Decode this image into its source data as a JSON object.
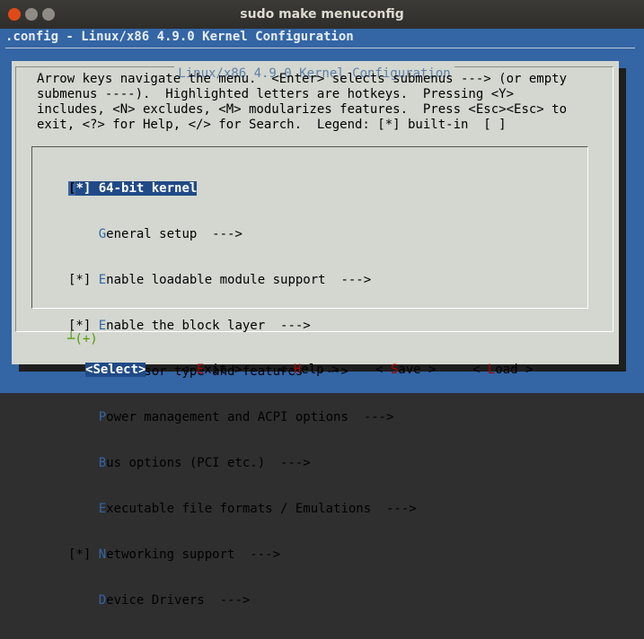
{
  "window": {
    "title": "sudo make menuconfig"
  },
  "terminal": {
    "config_title": ".config - Linux/x86 4.9.0 Kernel Configuration"
  },
  "dialog": {
    "title": "Linux/x86 4.9.0 Kernel Configuration",
    "help_lines": [
      "Arrow keys navigate the menu.  <Enter> selects submenus ---> (or empty",
      "submenus ----).  Highlighted letters are hotkeys.  Pressing <Y>",
      "includes, <N> excludes, <M> modularizes features.  Press <Esc><Esc> to",
      "exit, <?> for Help, </> for Search.  Legend: [*] built-in  [ ]"
    ]
  },
  "menu": {
    "items": [
      {
        "prefix": "[*] ",
        "hot": "6",
        "rest": "4-bit kernel",
        "selected": true
      },
      {
        "prefix": "    ",
        "hot": "G",
        "rest": "eneral setup  --->"
      },
      {
        "prefix": "[*] ",
        "hot": "E",
        "rest": "nable loadable module support  --->"
      },
      {
        "prefix": "[*] ",
        "hot": "E",
        "rest": "nable the block layer  --->"
      },
      {
        "prefix": "    ",
        "hot": "P",
        "rest": "rocessor type and features  --->"
      },
      {
        "prefix": "    ",
        "hot": "P",
        "rest": "ower management and ACPI options  --->"
      },
      {
        "prefix": "    ",
        "hot": "B",
        "rest": "us options (PCI etc.)  --->"
      },
      {
        "prefix": "    ",
        "hot": "E",
        "rest": "xecutable file formats / Emulations  --->"
      },
      {
        "prefix": "[*] ",
        "hot": "N",
        "rest": "etworking support  --->"
      },
      {
        "prefix": "    ",
        "hot": "D",
        "rest": "evice Drivers  --->"
      }
    ],
    "more_indicator": "┴(+)"
  },
  "buttons": {
    "select": {
      "open": "<",
      "hot": "S",
      "rest": "elect>"
    },
    "exit": {
      "open": "< ",
      "hot": "E",
      "rest": "xit >"
    },
    "help": {
      "open": "< ",
      "hot": "H",
      "rest": "elp >"
    },
    "save": {
      "open": "< ",
      "hot": "S",
      "rest": "ave >"
    },
    "load": {
      "open": "< ",
      "hot": "L",
      "rest": "oad >"
    }
  },
  "colors": {
    "terminal_bg": "#3465a4",
    "dialog_bg": "#d3d7cf",
    "selection_bg": "#204a87",
    "hotkey": "#3465a4"
  }
}
